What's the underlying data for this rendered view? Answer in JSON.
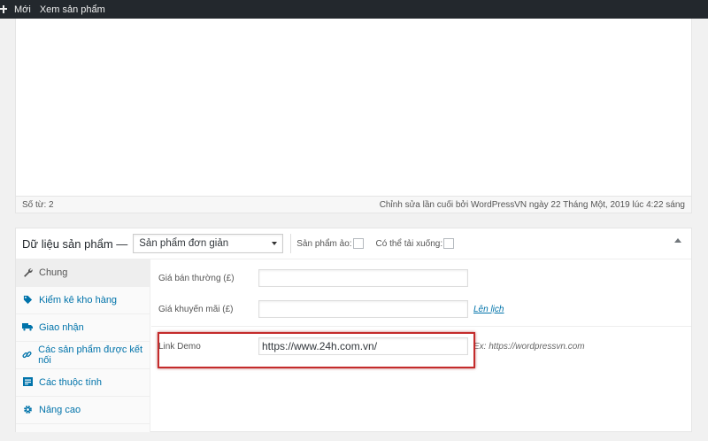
{
  "adminbar": {
    "new_label": "Mới",
    "view_product_label": "Xem sản phẩm"
  },
  "editor": {
    "word_count": "Số từ: 2",
    "last_edit": "Chỉnh sửa lần cuối bởi WordPressVN ngày 22 Tháng Một, 2019 lúc 4:22 sáng"
  },
  "product_data": {
    "title": "Dữ liệu sản phẩm —",
    "type_select": "Sản phẩm đơn giản",
    "virtual_label": "Sản phẩm ảo:",
    "downloadable_label": "Có thể tải xuống:"
  },
  "tabs": [
    {
      "label": "Chung",
      "icon": "wrench-icon"
    },
    {
      "label": "Kiểm kê kho hàng",
      "icon": "tag-icon"
    },
    {
      "label": "Giao nhận",
      "icon": "truck-icon"
    },
    {
      "label": "Các sản phẩm được kết nối",
      "icon": "link-icon"
    },
    {
      "label": "Các thuộc tính",
      "icon": "list-icon"
    },
    {
      "label": "Nâng cao",
      "icon": "gear-icon"
    }
  ],
  "fields": {
    "regular_price_label": "Giá bán thường (£)",
    "regular_price_value": "",
    "sale_price_label": "Giá khuyến mãi (£)",
    "sale_price_value": "",
    "schedule_link": "Lên lịch",
    "demo_label": "Link Demo",
    "demo_value": "https://www.24h.com.vn/",
    "demo_hint": "Ex: https://wordpressvn.com"
  },
  "colors": {
    "adminbar": "#23282d",
    "link": "#0073aa",
    "highlight": "#c42b2b"
  }
}
